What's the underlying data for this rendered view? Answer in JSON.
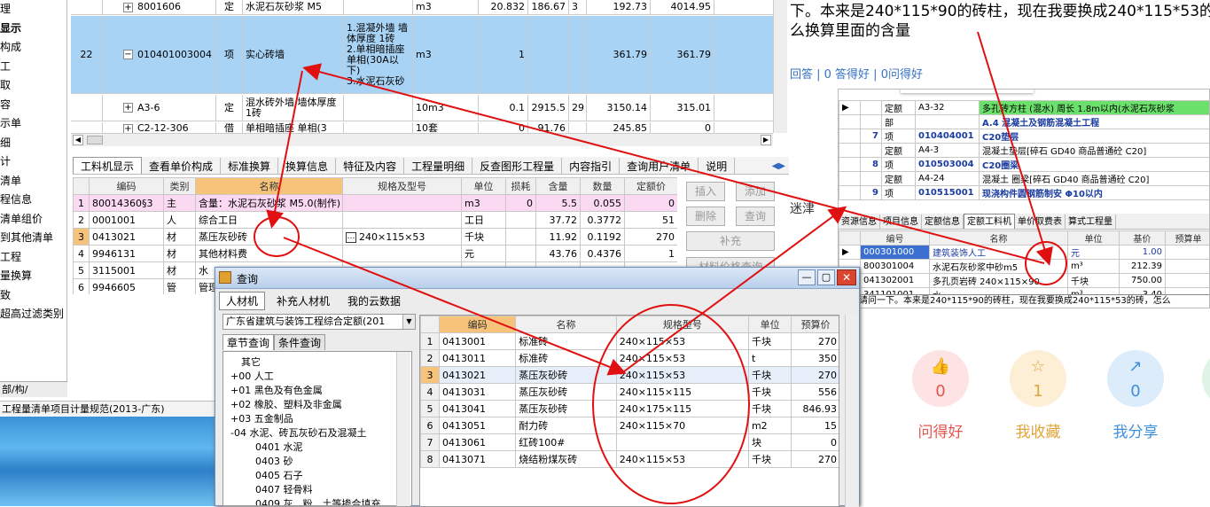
{
  "left_sidebar": {
    "items": [
      "理",
      "显示",
      "构成",
      "工",
      "取",
      "容",
      "示单",
      "细",
      "计",
      "清单",
      "程信息",
      "清单组价",
      "到其他清单",
      "工程",
      "量换算",
      "致",
      "超高过滤类别"
    ],
    "bottom_tab": "部/构/"
  },
  "bill_grid": {
    "rows": [
      {
        "no": "",
        "code": "8001606",
        "type": "定",
        "name": "水泥石灰砂浆 M5",
        "feature": "",
        "unit": "m3",
        "qty": "20.832",
        "price": "186.67",
        "x": "3",
        "total": "192.73",
        "sum": "4014.95"
      },
      {
        "no": "22",
        "code": "010401003004",
        "type": "项",
        "name": "实心砖墙",
        "feature": "1.混凝外墙 墙体厚度 1砖\n2.单相暗插座 单相(30A以下)\n3.水泥石灰砂",
        "unit": "m3",
        "qty": "1",
        "price": "",
        "x": "",
        "total": "361.79",
        "sum": "361.79"
      },
      {
        "no": "",
        "code": "A3-6",
        "type": "定",
        "name": "混水砖外墙 墙体厚度 1砖",
        "feature": "",
        "unit": "10m3",
        "qty": "0.1",
        "price": "2915.5",
        "x": "29",
        "total": "3150.14",
        "sum": "315.01"
      },
      {
        "no": "",
        "code": "C2-12-306",
        "type": "借",
        "name": "单相暗插座 单相(3",
        "feature": "",
        "unit": "10套",
        "qty": "0",
        "price": "91.76",
        "x": "",
        "total": "245.85",
        "sum": "0"
      }
    ]
  },
  "tabs": [
    "工料机显示",
    "查看单价构成",
    "标准换算",
    "换算信息",
    "特征及内容",
    "工程量明细",
    "反查图形工程量",
    "内容指引",
    "查询用户清单",
    "说明"
  ],
  "material_grid": {
    "headers": [
      "",
      "编码",
      "类别",
      "名称",
      "规格及型号",
      "单位",
      "损耗",
      "含量",
      "数量",
      "定额价"
    ],
    "rows": [
      [
        "1",
        "80014360§3",
        "主",
        "含量：水泥石灰砂浆 M5.0(制作)",
        "",
        "m3",
        "0",
        "5.5",
        "0.055",
        "0"
      ],
      [
        "2",
        "0001001",
        "人",
        "综合工日",
        "",
        "工日",
        "",
        "37.72",
        "0.3772",
        "51"
      ],
      [
        "3",
        "0413021",
        "材",
        "蒸压灰砂砖",
        "240×115×53",
        "千块",
        "",
        "11.92",
        "0.1192",
        "270"
      ],
      [
        "4",
        "9946131",
        "材",
        "其他材料费",
        "",
        "元",
        "",
        "43.76",
        "0.4376",
        "1"
      ],
      [
        "5",
        "3115001",
        "材",
        "水",
        "",
        "",
        "",
        "",
        "",
        ""
      ],
      [
        "6",
        "9946605",
        "管",
        "管理",
        "",
        "",
        "",
        "",
        "",
        ""
      ]
    ]
  },
  "side_buttons": [
    "插入",
    "添加",
    "删除",
    "查询",
    "补充",
    "材料价格查询"
  ],
  "status_bar": "工程量清单项目计量规范(2013-广东)",
  "query_dialog": {
    "title": "查询",
    "tabs": [
      "人材机",
      "补充人材机",
      "我的云数据"
    ],
    "dropdown": "广东省建筑与装饰工程综合定额(201",
    "subtabs": [
      "章节查询",
      "条件查询"
    ],
    "tree": [
      {
        "label": "其它",
        "level": 1,
        "pm": ""
      },
      {
        "label": "00 人工",
        "level": 1,
        "pm": "+"
      },
      {
        "label": "01 黑色及有色金属",
        "level": 1,
        "pm": "+"
      },
      {
        "label": "02 橡胶、塑料及非金属",
        "level": 1,
        "pm": "+"
      },
      {
        "label": "03 五金制品",
        "level": 1,
        "pm": "+"
      },
      {
        "label": "04 水泥、砖瓦灰砂石及混凝土",
        "level": 1,
        "pm": "-"
      },
      {
        "label": "0401 水泥",
        "level": 2,
        "pm": ""
      },
      {
        "label": "0403 砂",
        "level": 2,
        "pm": ""
      },
      {
        "label": "0405 石子",
        "level": 2,
        "pm": ""
      },
      {
        "label": "0407 轻骨料",
        "level": 2,
        "pm": ""
      },
      {
        "label": "0409 灰、粉、土等掺合填充",
        "level": 2,
        "pm": ""
      }
    ],
    "headers": [
      "",
      "编码",
      "名称",
      "规格型号",
      "单位",
      "预算价"
    ],
    "rows": [
      [
        "1",
        "0413001",
        "标准砖",
        "240×115×53",
        "千块",
        "270"
      ],
      [
        "2",
        "0413011",
        "标准砖",
        "240×115×53",
        "t",
        "350"
      ],
      [
        "3",
        "0413021",
        "蒸压灰砂砖",
        "240×115×53",
        "千块",
        "270"
      ],
      [
        "4",
        "0413031",
        "蒸压灰砂砖",
        "240×115×115",
        "千块",
        "556"
      ],
      [
        "5",
        "0413041",
        "蒸压灰砂砖",
        "240×175×115",
        "千块",
        "846.93"
      ],
      [
        "6",
        "0413051",
        "耐力砖",
        "240×115×70",
        "m2",
        "15"
      ],
      [
        "7",
        "0413061",
        "红砖100#",
        "",
        "块",
        "0"
      ],
      [
        "8",
        "0413071",
        "烧结粉煤灰砖",
        "240×115×53",
        "千块",
        "270"
      ]
    ]
  },
  "right_panel": {
    "question_line1": "下。本来是240*115*90的砖柱，现在我要换成240*115*53的",
    "question_line2": "么换算里面的含量",
    "meta": "回答 | 0 答得好 | 0问得好",
    "side_text": "迷津",
    "embedded_rows": [
      [
        "",
        "定额",
        "A3-32",
        "多孔砖方柱 (混水) 周长 1.8m以内(水泥石灰砂浆"
      ],
      [
        "",
        "部",
        "",
        "A.4 混凝土及钢筋混凝土工程"
      ],
      [
        "7",
        "项",
        "010404001",
        "C20垫层"
      ],
      [
        "",
        "定额",
        "A4-3",
        "混凝土垫层[碎石 GD40 商品普通砼 C20]"
      ],
      [
        "8",
        "项",
        "010503004",
        "C20圈梁"
      ],
      [
        "",
        "定额",
        "A4-24",
        "混凝土 圈梁[碎石 GD40 商品普通砼 C20]"
      ],
      [
        "9",
        "项",
        "010515001",
        "现浇构件圆钢筋制安 Φ10以内"
      ]
    ],
    "embedded_tabs": [
      "资源信息",
      "项目信息",
      "定额信息",
      "定额工料机",
      "单价取费表",
      "算式工程量"
    ],
    "embedded_headers": [
      "编号",
      "名称",
      "单位",
      "基价",
      "预算单"
    ],
    "embedded_rows2": [
      [
        "000301000",
        "建筑装饰人工",
        "元",
        "1.00"
      ],
      [
        "800301004",
        "水泥石灰砂浆中砂m5",
        "m³",
        "212.39"
      ],
      [
        "041302001",
        "多孔页岩砖 240×115×90",
        "千块",
        "750.00"
      ],
      [
        "341101001",
        "水",
        "m³",
        "3.40"
      ]
    ],
    "tooltip": "请问一下。本来是240*115*90的砖柱，现在我要换成240*115*53的砖，怎么",
    "stats": [
      {
        "label": "问得好",
        "count": "0",
        "color": "#e6564f",
        "bg": "#fde3e3"
      },
      {
        "label": "我收藏",
        "count": "1",
        "color": "#e0a43a",
        "bg": "#fcefd6"
      },
      {
        "label": "我分享",
        "count": "0",
        "color": "#3f8fd8",
        "bg": "#dcecfa"
      }
    ]
  },
  "colors": {
    "selected_row": "#a9d3f5",
    "annotation": "#e01010",
    "header_orange": "#f7c27a",
    "pink_row": "#fbd9f3"
  }
}
